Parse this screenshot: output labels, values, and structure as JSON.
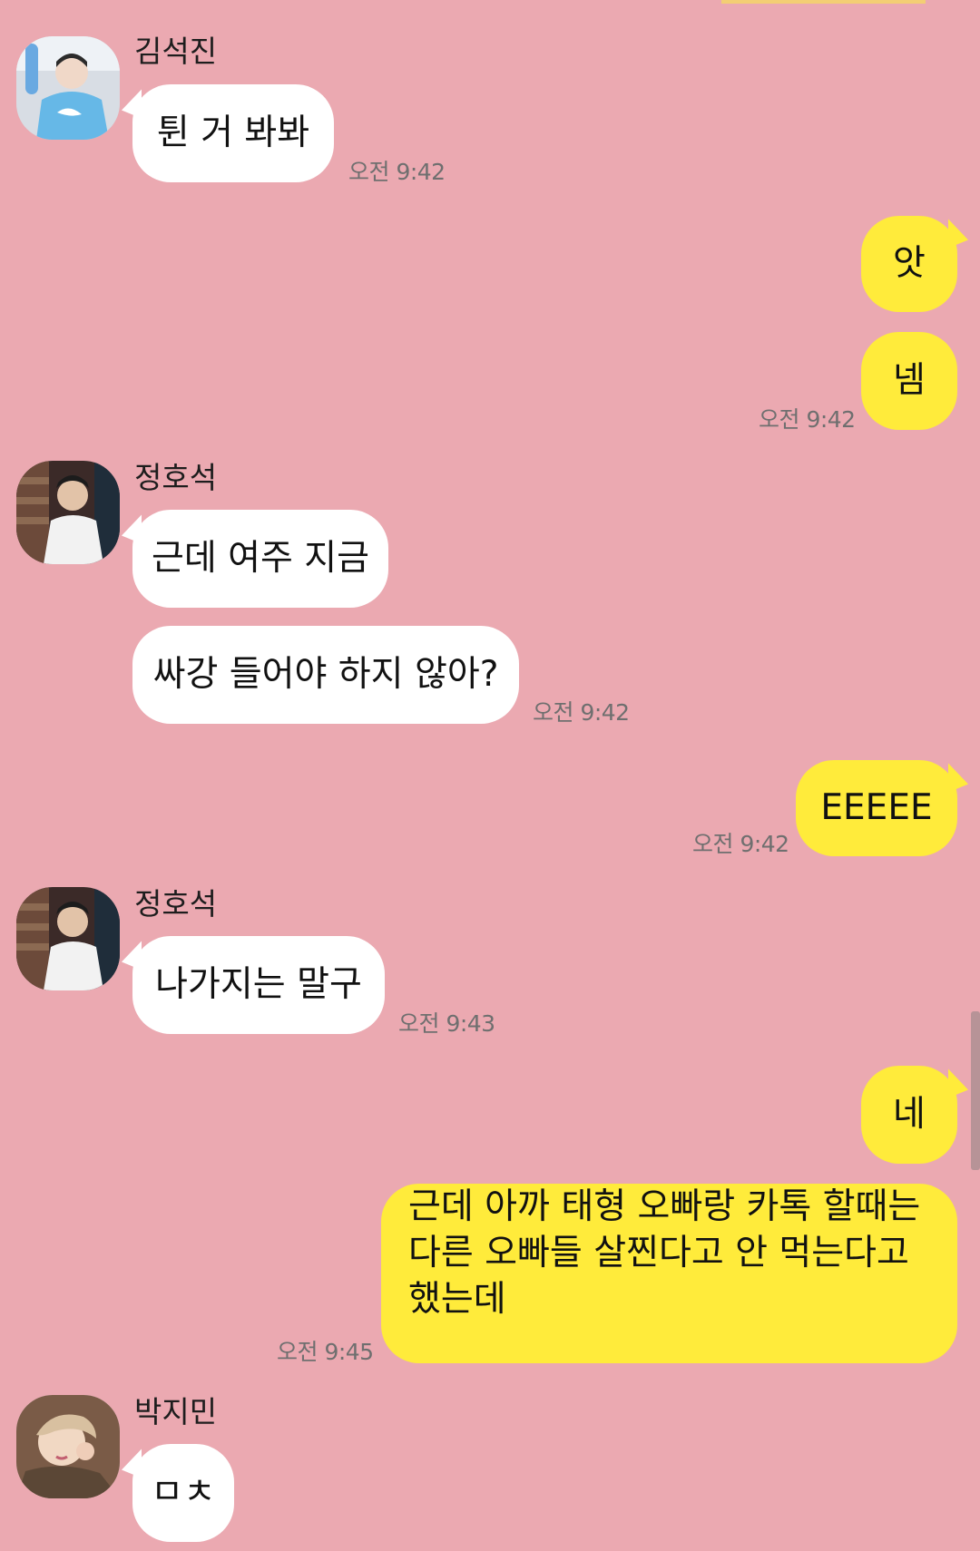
{
  "colors": {
    "background": "#eba9b1",
    "incoming_bubble": "#ffffff",
    "outgoing_bubble": "#ffeb3b",
    "timestamp": "#6f6f6f"
  },
  "messages": [
    {
      "sender": "김석진",
      "avatar": "avatar-photo",
      "direction": "incoming",
      "texts": [
        "튄 거 봐봐"
      ],
      "time": "오전 9:42"
    },
    {
      "direction": "outgoing",
      "texts": [
        "앗",
        "넴"
      ],
      "time": "오전 9:42"
    },
    {
      "sender": "정호석",
      "avatar": "avatar-photo",
      "direction": "incoming",
      "texts": [
        "근데 여주 지금",
        "싸강 들어야 하지 않아?"
      ],
      "time": "오전 9:42"
    },
    {
      "direction": "outgoing",
      "texts": [
        "EEEEE"
      ],
      "time": "오전 9:42"
    },
    {
      "sender": "정호석",
      "avatar": "avatar-photo",
      "direction": "incoming",
      "texts": [
        "나가지는 말구"
      ],
      "time": "오전 9:43"
    },
    {
      "direction": "outgoing",
      "texts": [
        "네",
        "근데 아까 태형 오빠랑 카톡 할때는 다른 오빠들 살찐다고 안 먹는다고 했는데"
      ],
      "time": "오전 9:45"
    },
    {
      "sender": "박지민",
      "avatar": "avatar-photo",
      "direction": "incoming",
      "texts": [
        "ㅁㅊ"
      ]
    }
  ]
}
